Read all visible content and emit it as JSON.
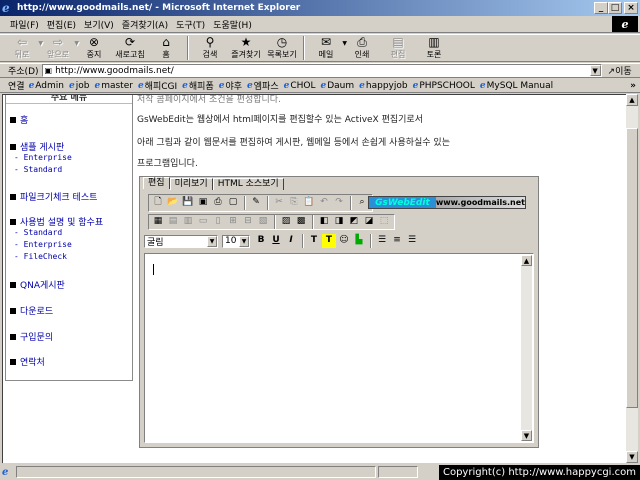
{
  "window": {
    "title": "http://www.goodmails.net/ - Microsoft Internet Explorer",
    "min_label": "_",
    "max_label": "□",
    "close_label": "×"
  },
  "menubar": {
    "items": [
      "파일(F)",
      "편집(E)",
      "보기(V)",
      "즐겨찾기(A)",
      "도구(T)",
      "도움말(H)"
    ]
  },
  "toolbar": {
    "buttons": [
      {
        "label": "뒤로",
        "icon": "back-arrow-icon",
        "enabled": false
      },
      {
        "label": "앞으로",
        "icon": "forward-arrow-icon",
        "enabled": false
      },
      {
        "label": "중지",
        "icon": "stop-icon",
        "enabled": true
      },
      {
        "label": "새로고침",
        "icon": "refresh-icon",
        "enabled": true
      },
      {
        "label": "홈",
        "icon": "home-icon",
        "enabled": true
      },
      {
        "label": "검색",
        "icon": "search-icon",
        "enabled": true
      },
      {
        "label": "즐겨찾기",
        "icon": "favorites-icon",
        "enabled": true
      },
      {
        "label": "목록보기",
        "icon": "history-icon",
        "enabled": true
      },
      {
        "label": "메일",
        "icon": "mail-icon",
        "enabled": true
      },
      {
        "label": "인쇄",
        "icon": "print-icon",
        "enabled": true
      },
      {
        "label": "편집",
        "icon": "edit-icon",
        "enabled": false
      },
      {
        "label": "토론",
        "icon": "discuss-icon",
        "enabled": true
      }
    ]
  },
  "address": {
    "label": "주소(D)",
    "url": "http://www.goodmails.net/",
    "go_label": "이동"
  },
  "links": {
    "label": "연결",
    "items": [
      "Admin",
      "job",
      "master",
      "해피CGI",
      "해피폼",
      "야후",
      "엠파스",
      "CHOL",
      "Daum",
      "happyjob",
      "PHPSCHOOL",
      "MySQL Manual"
    ],
    "more": "»"
  },
  "sidebar": {
    "header": "주요 메뉴",
    "items": [
      {
        "label": "홈",
        "subs": []
      },
      {
        "label": "샘플 게시판",
        "subs": [
          "- Enterprise",
          "- Standard"
        ]
      },
      {
        "label": "파일크기체크 테스트",
        "subs": []
      },
      {
        "label": "사용법 설명 및 함수표",
        "subs": [
          "- Standard",
          "- Enterprise",
          "- FileCheck"
        ]
      },
      {
        "label": "QNA게시판",
        "subs": []
      },
      {
        "label": "다운로드",
        "subs": []
      },
      {
        "label": "구입문의",
        "subs": []
      },
      {
        "label": "연락처",
        "subs": []
      }
    ]
  },
  "body": {
    "line0": "저작 콤페이지에서 조건을 편성합니다.",
    "line1": "GsWebEdit는 웹상에서 html페이지를 편집할수 있는 ActiveX 편집기로서",
    "line2": "아래 그림과 같이 웹문서를 편집하여 게시판, 웹메일 등에서 손쉽게 사용하실수 있는",
    "line3": "프로그램입니다."
  },
  "editor": {
    "tabs": [
      "편집",
      "미리보기",
      "HTML 소스보기"
    ],
    "brand_name": "GsWebEdit",
    "brand_url": "www.goodmails.net",
    "font_name": "굴림",
    "font_size": "10",
    "format_buttons": [
      "B",
      "U",
      "I",
      "T",
      "T"
    ]
  },
  "status": {
    "copyright": "Copyright(c) http://www.happycgi.com"
  },
  "colors": {
    "titlebar_start": "#0a246a",
    "titlebar_end": "#a6caf0",
    "link_blue": "#0000a8",
    "brand_blue": "#2a8fd6"
  }
}
